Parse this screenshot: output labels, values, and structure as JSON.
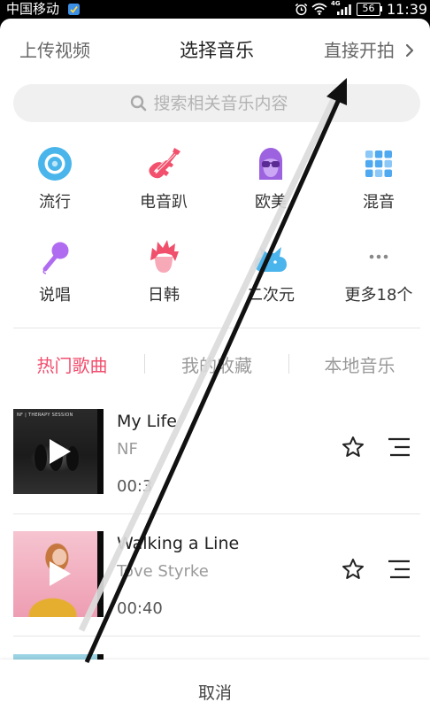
{
  "status_bar": {
    "carrier": "中国移动",
    "network": "4G",
    "battery": "56",
    "time": "11:39",
    "icons": [
      "notification-app-icon",
      "alarm-icon",
      "wifi-icon",
      "signal-icon",
      "battery-icon"
    ]
  },
  "header": {
    "upload_label": "上传视频",
    "title": "选择音乐",
    "shoot_label": "直接开拍",
    "shoot_icon": "chevron-right-icon"
  },
  "search": {
    "placeholder": "搜索相关音乐内容",
    "icon": "search-icon"
  },
  "categories": [
    {
      "label": "流行",
      "icon": "disc-icon",
      "color": "#49b5ea"
    },
    {
      "label": "电音趴",
      "icon": "electric-guitar-icon",
      "color": "#f2506c"
    },
    {
      "label": "欧美",
      "icon": "sunglasses-head-icon",
      "color": "#9d62df"
    },
    {
      "label": "混音",
      "icon": "dot-grid-icon",
      "color": "#4ea9f0"
    },
    {
      "label": "说唱",
      "icon": "microphone-icon",
      "color": "#b06cf0"
    },
    {
      "label": "日韩",
      "icon": "spiky-hair-avatar-icon",
      "color": "#f0506c"
    },
    {
      "label": "二次元",
      "icon": "cat-cloud-icon",
      "color": "#4ab4ec"
    },
    {
      "label": "更多18个",
      "icon": "more-dots-icon",
      "color": "#888888"
    }
  ],
  "tabs": [
    {
      "label": "热门歌曲",
      "active": true
    },
    {
      "label": "我的收藏",
      "active": false
    },
    {
      "label": "本地音乐",
      "active": false
    }
  ],
  "songs": [
    {
      "title": "My Life",
      "artist": "NF",
      "duration": "00:3",
      "cover_text": "NF | THERAPY SESSION"
    },
    {
      "title": "Walking a Line",
      "artist": "Tove Styrke",
      "duration": "00:40"
    }
  ],
  "row_icons": [
    "play-icon",
    "star-icon",
    "list-menu-icon"
  ],
  "footer": {
    "cancel_label": "取消"
  },
  "colors": {
    "accent": "#f04e6e",
    "text_primary": "#222222",
    "text_secondary": "#9a9a9a",
    "search_bg": "#f0f0f0",
    "status_bar_bg": "#000000"
  }
}
